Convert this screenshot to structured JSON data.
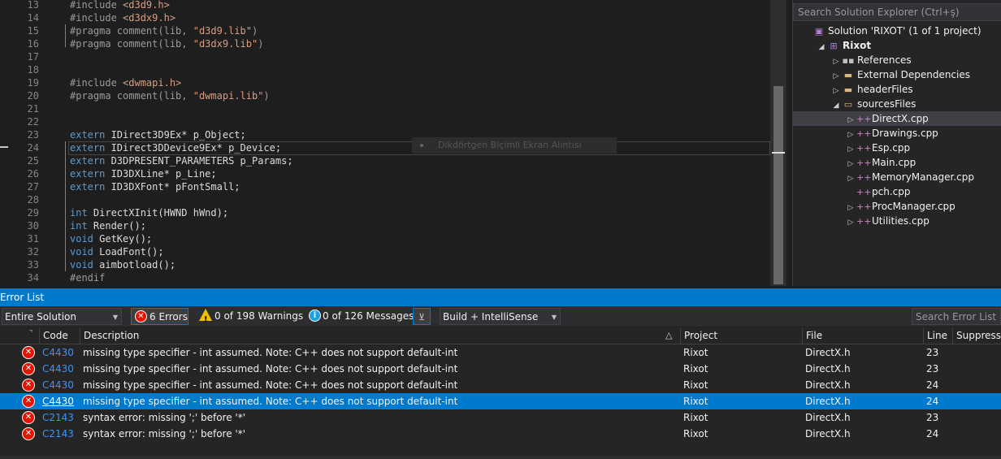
{
  "editor": {
    "lines": [
      {
        "n": "13",
        "parts": [
          [
            "pp",
            "#include "
          ],
          [
            "inc",
            "<d3d9.h>"
          ]
        ]
      },
      {
        "n": "14",
        "parts": [
          [
            "pp",
            "#include "
          ],
          [
            "inc",
            "<d3dx9.h>"
          ]
        ]
      },
      {
        "n": "15",
        "parts": [
          [
            "pp",
            "#pragma comment(lib, "
          ],
          [
            "str",
            "\"d3d9.lib\""
          ],
          [
            "pp",
            ")"
          ]
        ]
      },
      {
        "n": "16",
        "parts": [
          [
            "pp",
            "#pragma comment(lib, "
          ],
          [
            "str",
            "\"d3dx9.lib\""
          ],
          [
            "pp",
            ")"
          ]
        ]
      },
      {
        "n": "17",
        "parts": []
      },
      {
        "n": "18",
        "parts": []
      },
      {
        "n": "19",
        "parts": [
          [
            "pp",
            "#include "
          ],
          [
            "inc",
            "<dwmapi.h>"
          ]
        ]
      },
      {
        "n": "20",
        "parts": [
          [
            "pp",
            "#pragma comment(lib, "
          ],
          [
            "str",
            "\"dwmapi.lib\""
          ],
          [
            "pp",
            ")"
          ]
        ]
      },
      {
        "n": "21",
        "parts": []
      },
      {
        "n": "22",
        "parts": []
      },
      {
        "n": "23",
        "parts": [
          [
            "kw",
            "extern"
          ],
          [
            "typ",
            " IDirect3D9Ex* p_Object;"
          ]
        ]
      },
      {
        "n": "24",
        "parts": [
          [
            "kw",
            "extern"
          ],
          [
            "typ",
            " IDirect3DDevice9Ex* p_Device;"
          ]
        ]
      },
      {
        "n": "25",
        "parts": [
          [
            "kw",
            "extern"
          ],
          [
            "typ",
            " D3DPRESENT_PARAMETERS p_Params;"
          ]
        ]
      },
      {
        "n": "26",
        "parts": [
          [
            "kw",
            "extern"
          ],
          [
            "typ",
            " ID3DXLine* p_Line;"
          ]
        ]
      },
      {
        "n": "27",
        "parts": [
          [
            "kw",
            "extern"
          ],
          [
            "typ",
            " ID3DXFont* pFontSmall;"
          ]
        ]
      },
      {
        "n": "28",
        "parts": []
      },
      {
        "n": "29",
        "parts": [
          [
            "kw",
            "int"
          ],
          [
            "typ",
            " DirectXInit(HWND hWnd);"
          ]
        ]
      },
      {
        "n": "30",
        "parts": [
          [
            "kw",
            "int"
          ],
          [
            "typ",
            " Render();"
          ]
        ]
      },
      {
        "n": "31",
        "parts": [
          [
            "kw",
            "void"
          ],
          [
            "typ",
            " GetKey();"
          ]
        ]
      },
      {
        "n": "32",
        "parts": [
          [
            "kw",
            "void"
          ],
          [
            "typ",
            " LoadFont();"
          ]
        ]
      },
      {
        "n": "33",
        "parts": [
          [
            "kw",
            "void"
          ],
          [
            "typ",
            " aimbotload();"
          ]
        ]
      },
      {
        "n": "34",
        "parts": [
          [
            "pp",
            "#endif"
          ]
        ]
      }
    ],
    "tooltip_text": "Dikdörtgen Biçimli Ekran Alıntısı"
  },
  "solution_explorer": {
    "search_placeholder": "Search Solution Explorer (Ctrl+ş)",
    "items": [
      {
        "label": "Solution 'RIXOT' (1 of 1 project)",
        "indent": 0,
        "arrow": "",
        "icon": "solution-icon",
        "glyph": "▣",
        "cls": "proj",
        "bold": false
      },
      {
        "label": "Rixot",
        "indent": 1,
        "arrow": "◢",
        "icon": "project-icon",
        "glyph": "⊞",
        "cls": "proj",
        "bold": true
      },
      {
        "label": "References",
        "indent": 2,
        "arrow": "▷",
        "icon": "references-icon",
        "glyph": "▪▪",
        "cls": "ref",
        "bold": false
      },
      {
        "label": "External Dependencies",
        "indent": 2,
        "arrow": "▷",
        "icon": "folder-icon",
        "glyph": "▬",
        "cls": "fold",
        "bold": false
      },
      {
        "label": "headerFiles",
        "indent": 2,
        "arrow": "▷",
        "icon": "folder-icon",
        "glyph": "▬",
        "cls": "fold",
        "bold": false
      },
      {
        "label": "sourcesFiles",
        "indent": 2,
        "arrow": "◢",
        "icon": "folder-icon",
        "glyph": "▭",
        "cls": "fold",
        "bold": false
      },
      {
        "label": "DirectX.cpp",
        "indent": 3,
        "arrow": "▷",
        "icon": "cpp-file-icon",
        "glyph": "++",
        "cls": "cpp",
        "bold": false,
        "selected": true
      },
      {
        "label": "Drawings.cpp",
        "indent": 3,
        "arrow": "▷",
        "icon": "cpp-file-icon",
        "glyph": "++",
        "cls": "cpp",
        "bold": false
      },
      {
        "label": "Esp.cpp",
        "indent": 3,
        "arrow": "▷",
        "icon": "cpp-file-icon",
        "glyph": "++",
        "cls": "cpp",
        "bold": false
      },
      {
        "label": "Main.cpp",
        "indent": 3,
        "arrow": "▷",
        "icon": "cpp-file-icon",
        "glyph": "++",
        "cls": "cpp",
        "bold": false
      },
      {
        "label": "MemoryManager.cpp",
        "indent": 3,
        "arrow": "▷",
        "icon": "cpp-file-icon",
        "glyph": "++",
        "cls": "cpp",
        "bold": false
      },
      {
        "label": "pch.cpp",
        "indent": 3,
        "arrow": "",
        "icon": "cpp-file-icon",
        "glyph": "++",
        "cls": "cpp",
        "bold": false
      },
      {
        "label": "ProcManager.cpp",
        "indent": 3,
        "arrow": "▷",
        "icon": "cpp-file-icon",
        "glyph": "++",
        "cls": "cpp",
        "bold": false
      },
      {
        "label": "Utilities.cpp",
        "indent": 3,
        "arrow": "▷",
        "icon": "cpp-file-icon",
        "glyph": "++",
        "cls": "cpp",
        "bold": false
      }
    ]
  },
  "error_list": {
    "title": "Error List",
    "scope": "Entire Solution",
    "errors_label": "6 Errors",
    "warnings_label": "0 of 198 Warnings",
    "messages_label": "0 of 126 Messages",
    "build_filter": "Build + IntelliSense",
    "search_placeholder": "Search Error List",
    "columns": {
      "code": "Code",
      "description": "Description",
      "project": "Project",
      "file": "File",
      "line": "Line",
      "suppression": "Suppressio"
    },
    "rows": [
      {
        "code": "C4430",
        "description": "missing type specifier - int assumed. Note: C++ does not support default-int",
        "project": "Rixot",
        "file": "DirectX.h",
        "line": "23"
      },
      {
        "code": "C4430",
        "description": "missing type specifier - int assumed. Note: C++ does not support default-int",
        "project": "Rixot",
        "file": "DirectX.h",
        "line": "23"
      },
      {
        "code": "C4430",
        "description": "missing type specifier - int assumed. Note: C++ does not support default-int",
        "project": "Rixot",
        "file": "DirectX.h",
        "line": "24"
      },
      {
        "code": "C4430",
        "description": "missing type specifier - int assumed. Note: C++ does not support default-int",
        "project": "Rixot",
        "file": "DirectX.h",
        "line": "24",
        "selected": true
      },
      {
        "code": "C2143",
        "description": "syntax error: missing ';' before '*'",
        "project": "Rixot",
        "file": "DirectX.h",
        "line": "23"
      },
      {
        "code": "C2143",
        "description": "syntax error: missing ';' before '*'",
        "project": "Rixot",
        "file": "DirectX.h",
        "line": "24"
      }
    ]
  }
}
